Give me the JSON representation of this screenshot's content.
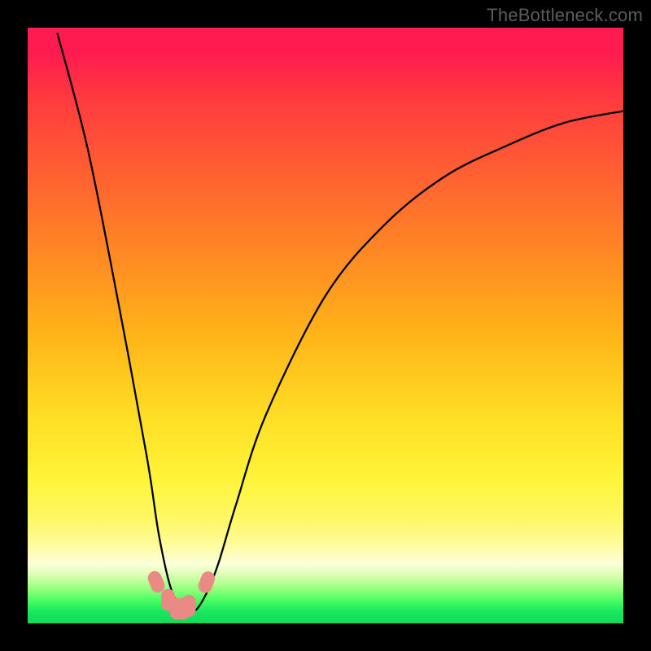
{
  "watermark": "TheBottleneck.com",
  "chart_data": {
    "type": "line",
    "title": "",
    "xlabel": "",
    "ylabel": "",
    "xlim": [
      0,
      100
    ],
    "ylim": [
      0,
      100
    ],
    "grid": false,
    "series": [
      {
        "name": "bottleneck-curve",
        "x": [
          5,
          10,
          15,
          20,
          22,
          24,
          26,
          28,
          30,
          32,
          35,
          40,
          50,
          60,
          70,
          80,
          90,
          100
        ],
        "y": [
          99,
          80,
          55,
          28,
          15,
          6,
          2,
          2,
          5,
          10,
          20,
          35,
          55,
          67,
          75,
          80,
          84,
          86
        ]
      }
    ],
    "markers": {
      "name": "highlight-points",
      "x": [
        21.5,
        23.5,
        25,
        26,
        27,
        30
      ],
      "y": [
        7,
        4,
        2.5,
        2.5,
        3,
        7
      ]
    },
    "gradient_stops": [
      {
        "pos": 0,
        "color": "#ff1a50"
      },
      {
        "pos": 50,
        "color": "#ffb518"
      },
      {
        "pos": 80,
        "color": "#fff43a"
      },
      {
        "pos": 95,
        "color": "#4fff65"
      },
      {
        "pos": 100,
        "color": "#15d85e"
      }
    ]
  }
}
